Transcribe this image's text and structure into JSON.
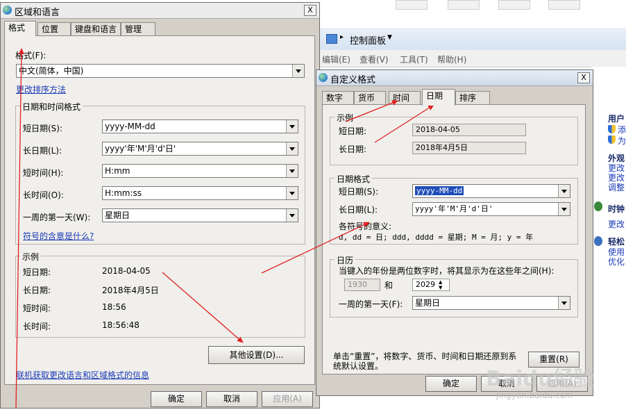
{
  "background": {
    "address_icon": "control-panel-icon",
    "address_text": "控制面板",
    "menu": [
      "编辑(E)",
      "查看(V)",
      "工具(T)",
      "帮助(H)"
    ],
    "side": {
      "user_heading": "用户",
      "user_items": [
        "添",
        "为"
      ],
      "appearance_heading": "外观",
      "appearance_items": [
        "更改",
        "更改",
        "调整"
      ],
      "clock_heading": "时钟",
      "clock_items": [
        "更改"
      ],
      "ease_heading": "轻松",
      "ease_items": [
        "使用",
        "优化"
      ]
    }
  },
  "region_dialog": {
    "title": "区域和语言",
    "close": "X",
    "tabs": [
      "格式",
      "位置",
      "键盘和语言",
      "管理"
    ],
    "format_label": "格式(F):",
    "format_value": "中文(简体，中国)",
    "sort_link": "更改排序方法",
    "datetime_group": "日期和时间格式",
    "rows": [
      {
        "label": "短日期(S):",
        "value": "yyyy-MM-dd"
      },
      {
        "label": "长日期(L):",
        "value": "yyyy'年'M'月'd'日'"
      },
      {
        "label": "短时间(H):",
        "value": "H:mm"
      },
      {
        "label": "长时间(O):",
        "value": "H:mm:ss"
      },
      {
        "label": "一周的第一天(W):",
        "value": "星期日"
      }
    ],
    "symbols_link": "符号的含意是什么?",
    "example_group": "示例",
    "examples": [
      {
        "label": "短日期:",
        "value": "2018-04-05"
      },
      {
        "label": "长日期:",
        "value": "2018年4月5日"
      },
      {
        "label": "短时间:",
        "value": "18:56"
      },
      {
        "label": "长时间:",
        "value": "18:56:48"
      }
    ],
    "other_settings": "其他设置(D)...",
    "online_link": "联机获取更改语言和区域格式的信息",
    "ok": "确定",
    "cancel": "取消",
    "apply": "应用(A)"
  },
  "custom_dialog": {
    "title": "自定义格式",
    "close": "X",
    "tabs": [
      "数字",
      "货币",
      "时间",
      "日期",
      "排序"
    ],
    "example_group": "示例",
    "short_label": "短日期:",
    "short_value": "2018-04-05",
    "long_label": "长日期:",
    "long_value": "2018年4月5日",
    "format_group": "日期格式",
    "fmt_short_label": "短日期(S):",
    "fmt_short_value": "yyyy-MM-dd",
    "fmt_long_label": "长日期(L):",
    "fmt_long_value": "yyyy'年'M'月'd'日'",
    "meaning_title": "各符号的意义:",
    "meaning_text": "d, dd = 日;  ddd, dddd = 星期;  M = 月;  y = 年",
    "calendar_group": "日历",
    "calendar_text": "当键入的年份是两位数字时，将其显示为在这些年之间(H):",
    "year_from": "1930",
    "and": "和",
    "year_to": "2029",
    "first_day_label": "一周的第一天(F):",
    "first_day_value": "星期日",
    "reset_text_1": "单击“重置”，将数字、货币、时间和日期还原到系",
    "reset_text_2": "统默认设置。",
    "reset": "重置(R)",
    "ok": "确定",
    "cancel": "取消",
    "apply": "应用(A)"
  },
  "watermark": {
    "brand": "Baidu经验",
    "url": "jingyan.baidu.com"
  },
  "colors": {
    "annotation_arrow": "#e02020",
    "link": "#1a3ab8",
    "selection": "#1e4db8"
  }
}
